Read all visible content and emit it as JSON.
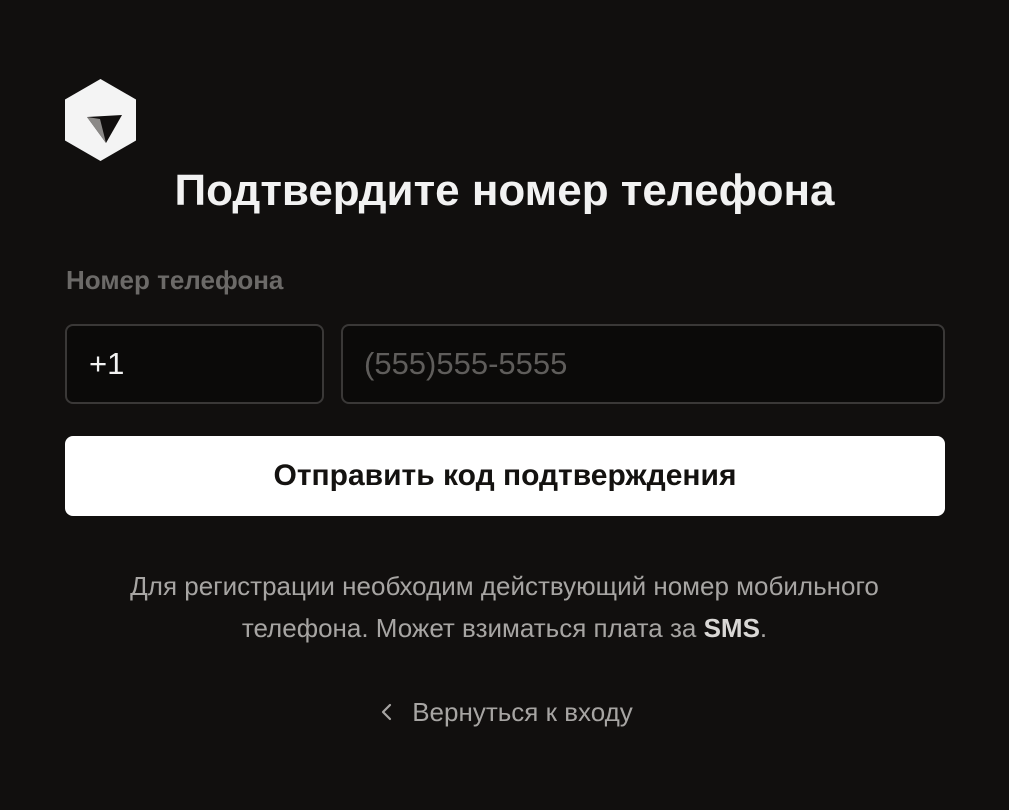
{
  "brand": {
    "logo_icon": "cube-logo-icon"
  },
  "title": "Подтвердите номер телефона",
  "phone_form": {
    "label": "Номер телефона",
    "country_code_value": "+1",
    "phone_value": "",
    "phone_placeholder": "(555)555-5555",
    "submit_label": "Отправить код подтверждения"
  },
  "hint": {
    "line1": "Для регистрации необходим действующий номер мобильного",
    "line2_prefix": "телефона. Может взиматься плата за ",
    "line2_emphasis": "SMS",
    "line2_suffix": "."
  },
  "back_link": {
    "icon": "chevron-left-icon",
    "label": "Вернуться к входу"
  },
  "colors": {
    "background": "#110f0e",
    "primary_button_bg": "#ffffff",
    "primary_button_text": "#141210",
    "input_border": "#3a3837",
    "muted_text": "#a7a5a3"
  }
}
